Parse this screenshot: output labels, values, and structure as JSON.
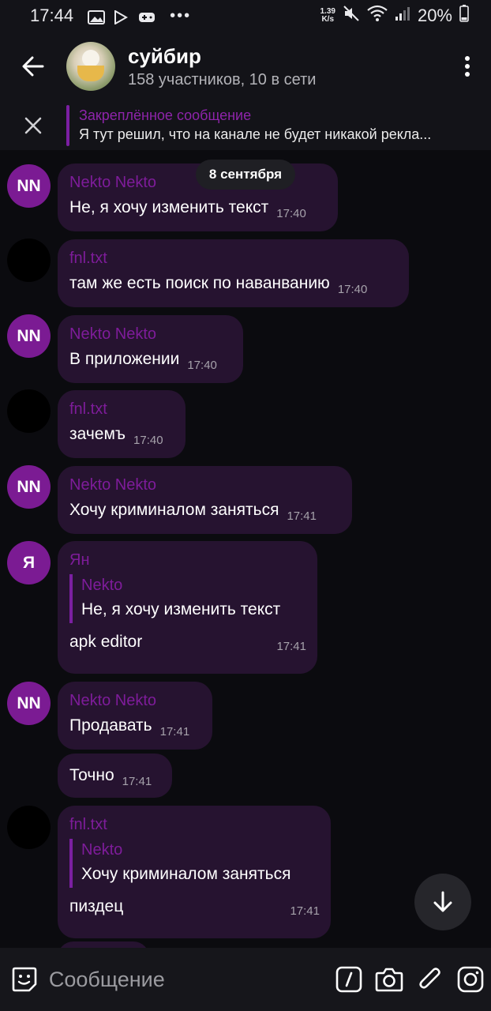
{
  "status_bar": {
    "time": "17:44",
    "speed_value": "1.39",
    "speed_unit": "K/s",
    "battery": "20%"
  },
  "header": {
    "title": "суйбир",
    "subtitle": "158 участников, 10 в сети"
  },
  "pinned": {
    "title": "Закреплённое сообщение",
    "text": "Я тут решил, что на канале не будет никакой рекла..."
  },
  "date_pill": "8 сентября",
  "messages": [
    {
      "avatar": "NN",
      "sender": "Nekto Nekto",
      "text": "Не, я хочу изменить текст",
      "time": "17:40"
    },
    {
      "avatar": "",
      "sender": "fnl.txt",
      "text": "там же есть поиск по наванванию",
      "time": "17:40"
    },
    {
      "avatar": "NN",
      "sender": "Nekto Nekto",
      "text": "В приложении",
      "time": "17:40"
    },
    {
      "avatar": "",
      "sender": "fnl.txt",
      "text": "зачемъ",
      "time": "17:40"
    },
    {
      "avatar": "NN",
      "sender": "Nekto Nekto",
      "text": "Хочу криминалом заняться",
      "time": "17:41"
    },
    {
      "avatar": "Я",
      "sender": "Ян",
      "reply_name": "Nekto",
      "reply_text": "Не, я хочу изменить текст",
      "text": "apk editor",
      "time": "17:41"
    },
    {
      "avatar": "NN",
      "sender": "Nekto Nekto",
      "text": "Продавать",
      "time": "17:41"
    },
    {
      "avatar": "",
      "sender": "",
      "text": "Точно",
      "time": "17:41"
    },
    {
      "avatar": "",
      "sender": "fnl.txt",
      "reply_name": "Nekto",
      "reply_text": "Хочу криминалом заняться",
      "text": "пиздец",
      "time": "17:41"
    }
  ],
  "input": {
    "placeholder": "Сообщение"
  },
  "colors": {
    "accent": "#7b1fa2",
    "bubble": "#261330",
    "background": "#0b0b0f"
  },
  "icons": [
    "back-arrow-icon",
    "more-vert-icon",
    "close-icon",
    "scroll-down-icon",
    "emoji-icon",
    "command-icon",
    "camera-icon",
    "attach-icon",
    "instagram-icon"
  ]
}
